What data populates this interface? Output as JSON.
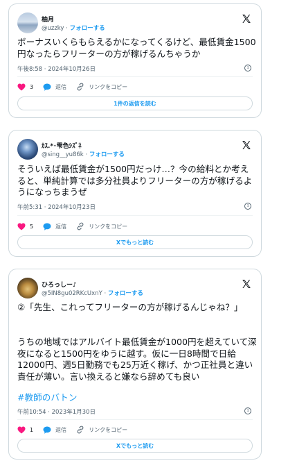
{
  "colors": {
    "accent": "#1d9bf0",
    "heart": "#f91880",
    "text": "#0f1419",
    "muted": "#536471",
    "border": "#cfd9de"
  },
  "posts": [
    {
      "name": "柚月",
      "handle": "@uzzky",
      "follow": "フォローする",
      "text": "ボーナスいくらもらえるかになってくるけど、最低賃金1500円なったらフリーターの方が稼げるんちゃうか",
      "timestamp": "午後8:58 · 2024年10月26日",
      "likes": "3",
      "reply": "返信",
      "copy_link": "リンクをコピー",
      "button": "1件の返信を読む"
    },
    {
      "name": "ｶｽ.*･雫色ｼｽﾞﾈ",
      "handle": "@sing__yu86k",
      "follow": "フォローする",
      "text": "そういえば最低賃金が1500円だっけ…？今の給料とか考えると、単純計算では多分社員よりフリーターの方が稼げるようになっちまうぜ",
      "timestamp": "午前5:31 · 2024年10月23日",
      "likes": "5",
      "reply": "返信",
      "copy_link": "リンクをコピー",
      "button": "Xでもっと読む"
    },
    {
      "name": "ひろっしー♪",
      "handle": "@5IN8gu02RKcUxnY",
      "follow": "フォローする",
      "text_p1": "②「先生、これってフリーターの方が稼げるんじゃね？」",
      "text_p2": "うちの地域ではアルバイト最低賃金が1000円を超えていて深夜になると1500円をゆうに越す。仮に一日8時間で日給12000円、週5日勤務でも25万近く稼げ、かつ正社員と違い責任が薄い。言い換えると嫌なら辞めても良い",
      "hashtag": "#教師のバトン",
      "timestamp": "午前10:54 · 2023年1月30日",
      "likes": "1",
      "reply": "返信",
      "copy_link": "リンクをコピー",
      "button": "Xでもっと読む"
    }
  ]
}
